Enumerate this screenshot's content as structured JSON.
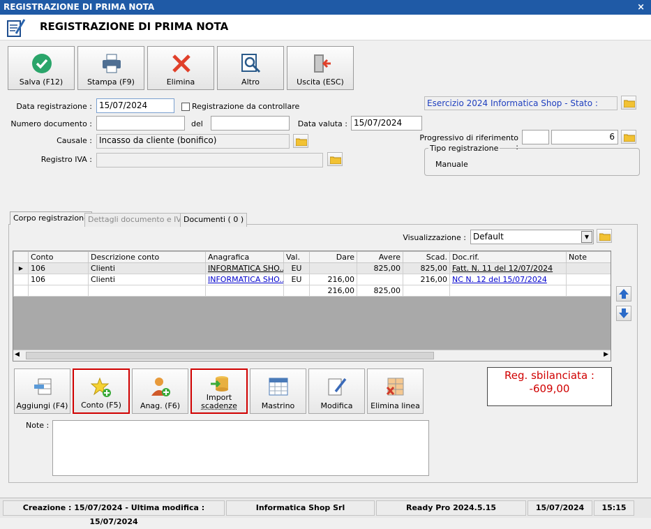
{
  "window": {
    "title": "REGISTRAZIONE DI PRIMA NOTA",
    "close": "×"
  },
  "header": {
    "title": "REGISTRAZIONE DI PRIMA NOTA"
  },
  "toolbar": {
    "save": "Salva (F12)",
    "print": "Stampa (F9)",
    "delete": "Elimina",
    "other": "Altro",
    "exit": "Uscita (ESC)"
  },
  "form": {
    "data_registrazione_label": "Data registrazione :",
    "data_registrazione": "15/07/2024",
    "da_controllare_label": "Registrazione da controllare",
    "numero_documento_label": "Numero documento :",
    "numero_documento": "",
    "del_label": "del",
    "del_value": "",
    "data_valuta_label": "Data valuta :",
    "data_valuta": "15/07/2024",
    "causale_label": "Causale :",
    "causale": "Incasso da cliente (bonifico)",
    "registro_iva_label": "Registro IVA :",
    "registro_iva": ""
  },
  "right": {
    "esercizio": "Esercizio 2024 Informatica Shop - Stato :",
    "progressivo_label": "Progressivo di riferimento :",
    "progressivo_a": "",
    "progressivo_b": "6",
    "tipo_label": "Tipo registrazione",
    "tipo_value": "Manuale"
  },
  "tabs": [
    "Corpo registrazione",
    "Dettagli documento e IVA",
    "Documenti ( 0 )"
  ],
  "view": {
    "label": "Visualizzazione :",
    "value": "Default"
  },
  "grid": {
    "headers": [
      "",
      "Conto",
      "Descrizione conto",
      "Anagrafica",
      "Val.",
      "Dare",
      "Avere",
      "Scad.",
      "Doc.rif.",
      "Note"
    ],
    "rows": [
      {
        "marker": "▶",
        "conto": "106",
        "descr": "Clienti",
        "anag": "INFORMATICA SHO...",
        "val": "EU",
        "dare": "",
        "avere": "825,00",
        "scad": "825,00",
        "docrif": "Fatt. N. 11 del 12/07/2024",
        "note": ""
      },
      {
        "marker": "",
        "conto": "106",
        "descr": "Clienti",
        "anag": "INFORMATICA SHO...",
        "val": "EU",
        "dare": "216,00",
        "avere": "",
        "scad": "216,00",
        "docrif": "NC N. 12 del 15/07/2024",
        "note": ""
      }
    ],
    "totals": {
      "dare": "216,00",
      "avere": "825,00"
    }
  },
  "actions": {
    "add": "Aggiungi (F4)",
    "conto": "Conto (F5)",
    "anag": "Anag. (F6)",
    "import_1": "Import",
    "import_2": "scadenze",
    "mastrino": "Mastrino",
    "modifica": "Modifica",
    "elimina_linea": "Elimina linea"
  },
  "balance": {
    "line1": "Reg. sbilanciata :",
    "line2": "-609,00"
  },
  "notes": {
    "label": "Note :",
    "value": ""
  },
  "status": {
    "dates": "Creazione : 15/07/2024 - Ultima modifica : 15/07/2024",
    "company": "Informatica Shop Srl",
    "version": "Ready Pro 2024.5.15",
    "date": "15/07/2024",
    "time": "15:15"
  },
  "colors": {
    "title_bar": "#1f5aa6",
    "balance_text": "#d00000",
    "highlight": "#d00000",
    "link": "#0000cc"
  }
}
